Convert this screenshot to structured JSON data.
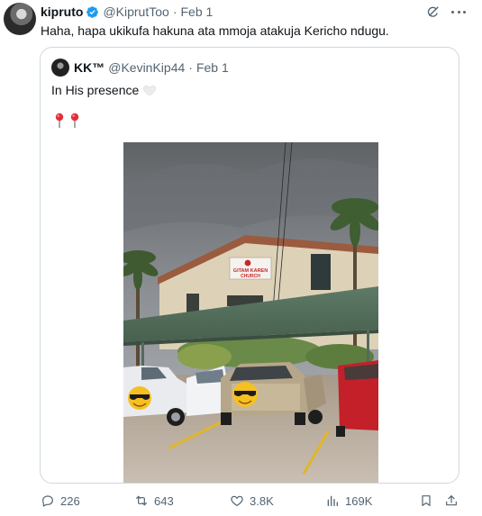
{
  "author": {
    "name": "kipruto",
    "handle": "@KiprutToo",
    "date": "Feb 1",
    "verified": true
  },
  "tweet_text": "Haha, hapa ukikufa hakuna ata mmoja atakuja Kericho ndugu.",
  "quoted": {
    "name": "KK™",
    "handle": "@KevinKip44",
    "date": "Feb 1",
    "text": "In His presence",
    "emoji": "white-heart",
    "pins": [
      "round-pushpin",
      "round-pushpin"
    ],
    "photo": {
      "sign_line1": "GITAM KAREN",
      "sign_line2": "CHURCH",
      "overlay_emoji": [
        "smiling-face-with-sunglasses",
        "smiling-face-with-sunglasses"
      ]
    }
  },
  "actions": {
    "replies": "226",
    "reposts": "643",
    "likes": "3.8K",
    "views": "169K"
  },
  "icons": {
    "verified": "verified-badge-icon",
    "grok": "grok-icon",
    "more": "more-icon",
    "reply": "reply-icon",
    "repost": "repost-icon",
    "like": "like-icon",
    "views": "views-icon",
    "bookmark": "bookmark-icon",
    "share": "share-icon"
  },
  "colors": {
    "text": "#0f1419",
    "secondary": "#536471",
    "border": "#cfd9de",
    "verified": "#1d9bf0"
  }
}
